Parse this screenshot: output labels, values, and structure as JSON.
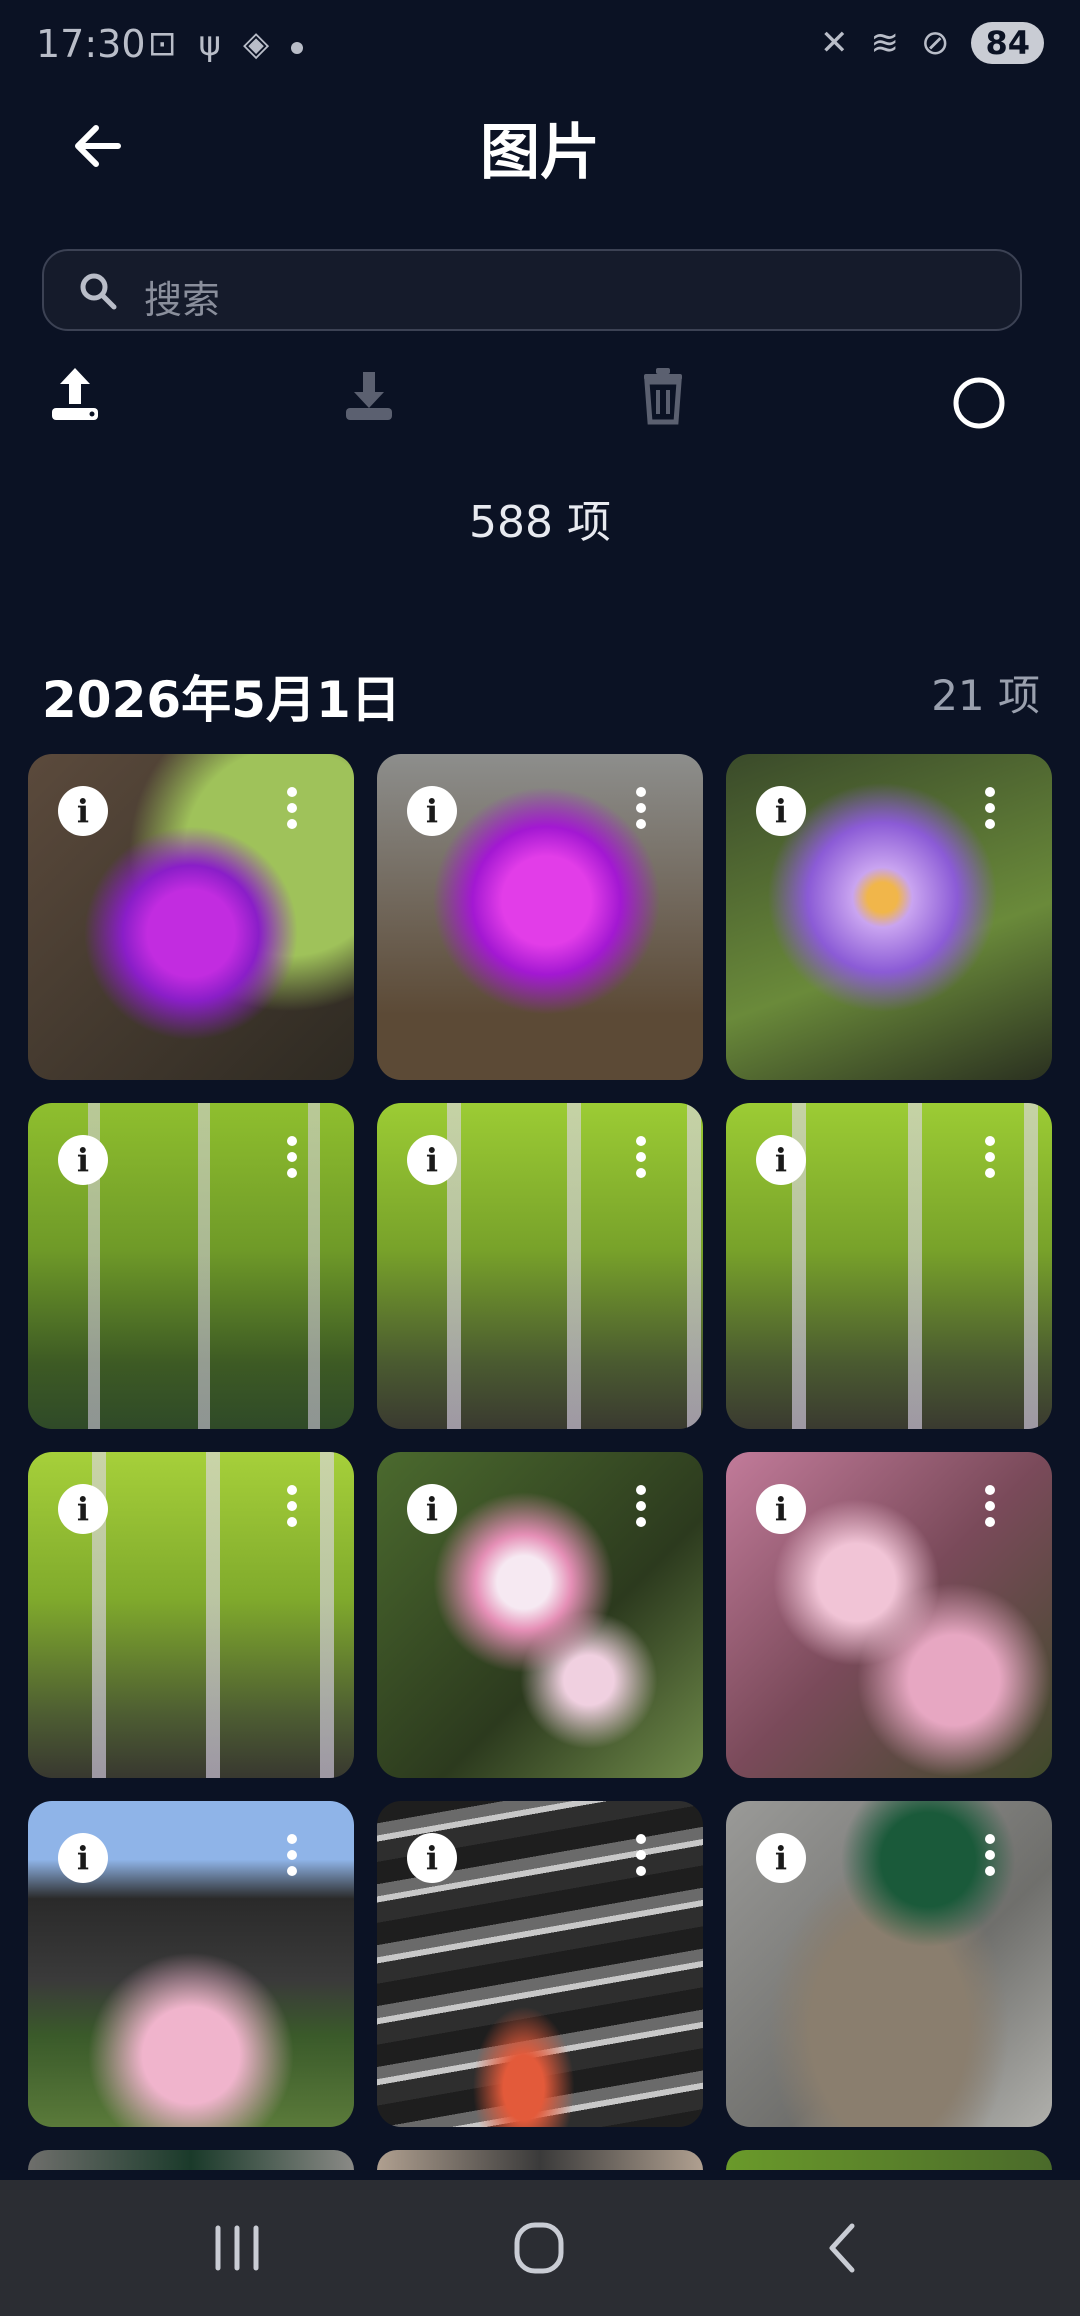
{
  "status": {
    "time": "17:30",
    "battery": "84"
  },
  "header": {
    "title": "图片"
  },
  "search": {
    "placeholder": "搜索"
  },
  "summary": {
    "total": "588 项"
  },
  "group": {
    "date": "2026年5月1日",
    "count": "21 项"
  },
  "info_glyph": "i",
  "photos": [
    {
      "subject": "purple flower"
    },
    {
      "subject": "magenta flower"
    },
    {
      "subject": "water lily"
    },
    {
      "subject": "wisteria"
    },
    {
      "subject": "wisteria"
    },
    {
      "subject": "wisteria"
    },
    {
      "subject": "wisteria"
    },
    {
      "subject": "pink blossoms"
    },
    {
      "subject": "pink blossoms"
    },
    {
      "subject": "roof with blossoms"
    },
    {
      "subject": "koi in water"
    },
    {
      "subject": "mallard duck"
    }
  ],
  "icons": {
    "back": "arrow-left-icon",
    "search": "search-icon",
    "upload": "upload-icon",
    "download": "download-icon",
    "delete": "trash-icon",
    "select": "circle-select-icon",
    "info": "info-icon",
    "more": "more-vert-icon"
  },
  "colors": {
    "background": "#0b1224",
    "navbar": "#2b2d33",
    "accent": "#ffffff"
  }
}
